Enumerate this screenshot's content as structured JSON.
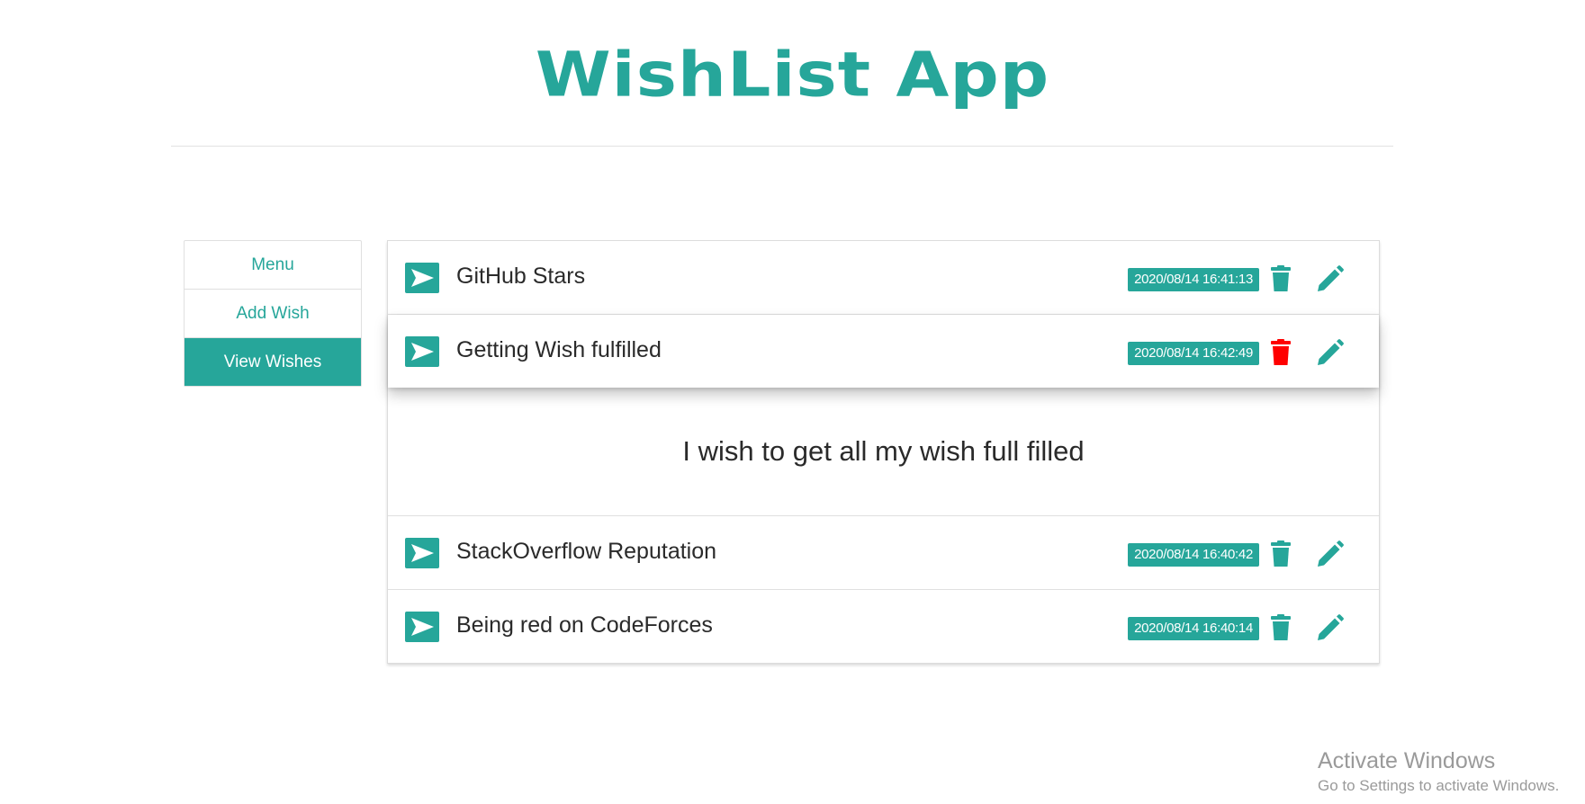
{
  "app": {
    "title": "WishList App"
  },
  "sidebar": {
    "items": [
      {
        "label": "Menu",
        "active": false
      },
      {
        "label": "Add Wish",
        "active": false
      },
      {
        "label": "View Wishes",
        "active": true
      }
    ]
  },
  "wishes": [
    {
      "title": "GitHub Stars",
      "timestamp": "2020/08/14 16:41:13",
      "delete_color": "#26a69a",
      "expanded": false
    },
    {
      "title": "Getting Wish fulfilled",
      "timestamp": "2020/08/14 16:42:49",
      "delete_color": "#ff0000",
      "expanded": true,
      "detail": "I wish to get all my wish full filled"
    },
    {
      "title": "StackOverflow Reputation",
      "timestamp": "2020/08/14 16:40:42",
      "delete_color": "#26a69a",
      "expanded": false
    },
    {
      "title": "Being red on CodeForces",
      "timestamp": "2020/08/14 16:40:14",
      "delete_color": "#26a69a",
      "expanded": false
    }
  ],
  "icons": {
    "row_icon": "send-icon",
    "delete": "trash-icon",
    "edit": "pencil-icon"
  },
  "colors": {
    "accent": "#26a69a",
    "danger": "#ff0000"
  },
  "watermark": {
    "line1": "Activate Windows",
    "line2": "Go to Settings to activate Windows."
  }
}
